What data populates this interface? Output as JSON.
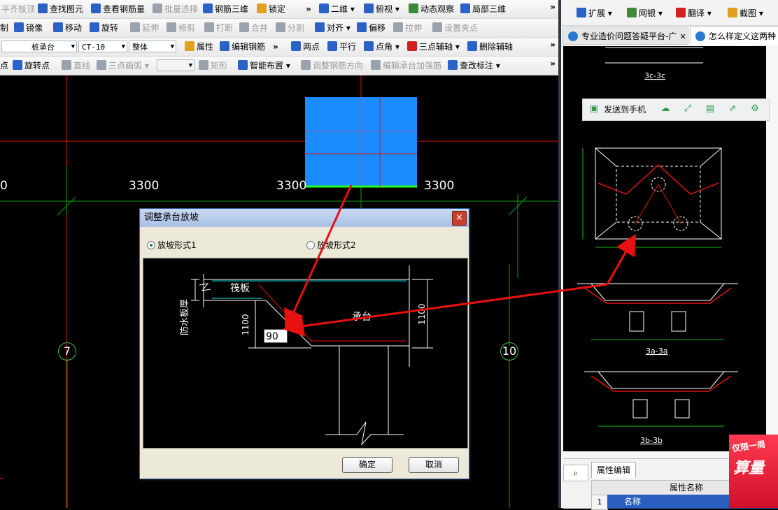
{
  "toolbar": {
    "row1": [
      "平齐板顶",
      "查找图元",
      "查看钢筋量",
      "批量选择",
      "钢筋三维",
      "锁定",
      "二维",
      "俯视",
      "动态观察",
      "局部三维"
    ],
    "row2": [
      "制",
      "镜像",
      "移动",
      "旋转",
      "延伸",
      "修剪",
      "打断",
      "合并",
      "分割",
      "对齐",
      "偏移",
      "拉伸",
      "设置夹点"
    ],
    "row3": {
      "combo1": "桩承台",
      "combo2": "CT-10",
      "combo3": "整体",
      "items": [
        "属性",
        "编辑钢筋",
        "两点",
        "平行",
        "点角",
        "三点辅轴",
        "删除辅轴"
      ]
    },
    "row4": [
      "点",
      "旋转点",
      "直线",
      "三点画弧",
      "矩形",
      "智能布置",
      "调整钢筋方向",
      "编辑承台加强筋",
      "查改标注"
    ],
    "more": "»"
  },
  "canvas": {
    "dims": [
      "0",
      "3300",
      "3300",
      "3300"
    ],
    "axis_labels": [
      "7",
      "10"
    ],
    "colors": {
      "grid_red": "#e01010",
      "grid_green": "#10a010",
      "pile_cap": "#1a8cff",
      "pile_cap_edge": "#20ff20",
      "arrow": "#e81010"
    }
  },
  "dialog": {
    "title": "调整承台放坡",
    "close": "×",
    "option1": "放坡形式1",
    "option2": "放坡形式2",
    "selected": "放坡形式1",
    "preview": {
      "label_raft": "筏板",
      "label_waterproof": "防水板厚",
      "label_cap": "承台",
      "dim_left": "1100",
      "dim_right": "1100",
      "angle_value": "90"
    },
    "ok": "确定",
    "cancel": "取消"
  },
  "browser": {
    "toolbar": [
      "扩展",
      "网银",
      "翻译",
      "截图"
    ],
    "tabs": [
      "专业造价问题答疑平台-广",
      "怎么样定义这两种"
    ],
    "send_to_phone": "发送到手机",
    "section_labels": [
      "3c-3c",
      "3a-3a",
      "3b-3b"
    ],
    "props_tab": "属性编辑",
    "props_header": "属性名称",
    "props_row_num": "1",
    "props_row_name": "名称",
    "ad_text1": "仅限一周",
    "ad_text2": "算量"
  }
}
